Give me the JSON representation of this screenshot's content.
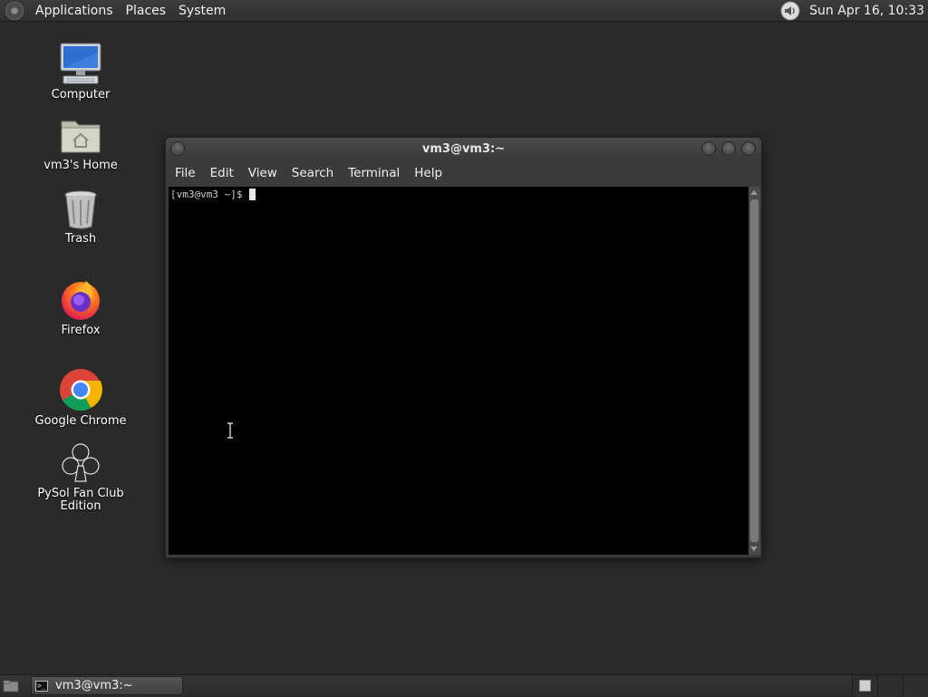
{
  "top_panel": {
    "menus": [
      "Applications",
      "Places",
      "System"
    ],
    "clock": "Sun Apr 16, 10:33",
    "icons": {
      "logo": "gnome-foot-icon",
      "volume": "speaker-volume-icon"
    }
  },
  "desktop": {
    "icons": [
      {
        "label": "Computer",
        "icon": "computer-icon"
      },
      {
        "label": "vm3's Home",
        "icon": "home-folder-icon"
      },
      {
        "label": "Trash",
        "icon": "trash-icon"
      },
      {
        "label": "Firefox",
        "icon": "firefox-icon"
      },
      {
        "label": "Google Chrome",
        "icon": "chrome-icon"
      },
      {
        "label": "PySol Fan Club Edition",
        "icon": "club-cards-icon"
      }
    ]
  },
  "terminal": {
    "title": "vm3@vm3:~",
    "menu": [
      "File",
      "Edit",
      "View",
      "Search",
      "Terminal",
      "Help"
    ],
    "prompt": "[vm3@vm3 ~]$ ",
    "colors": {
      "background": "#000000",
      "text": "#d0d0d0"
    }
  },
  "bottom_panel": {
    "tasks": [
      {
        "label": "vm3@vm3:~",
        "icon": "terminal-icon"
      }
    ],
    "workspaces": 3,
    "active_workspace": 1
  }
}
